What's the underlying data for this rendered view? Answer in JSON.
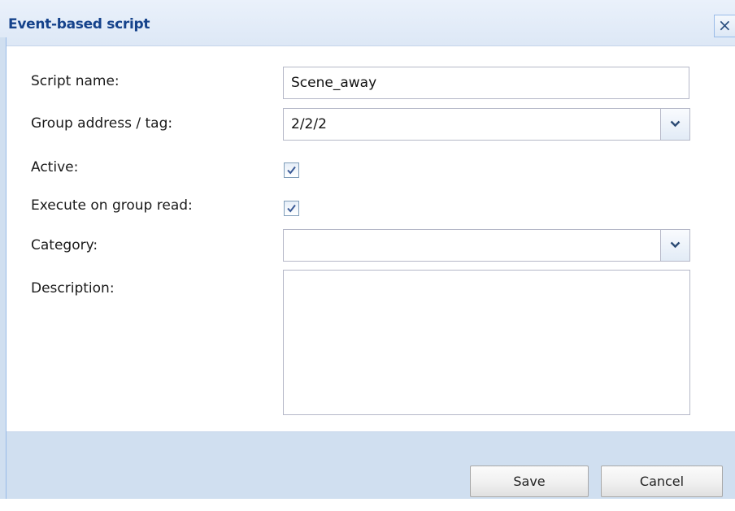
{
  "window": {
    "title": "Event-based script",
    "close_icon": "close-icon",
    "close_glyph": "✕"
  },
  "form": {
    "script_name_label": "Script name:",
    "script_name_value": "Scene_away",
    "group_address_label": "Group address / tag:",
    "group_address_value": "2/2/2",
    "active_label": "Active:",
    "active_checked": true,
    "execute_on_read_label": "Execute on group read:",
    "execute_on_read_checked": true,
    "category_label": "Category:",
    "category_value": "",
    "description_label": "Description:",
    "description_value": ""
  },
  "buttons": {
    "save_label": "Save",
    "cancel_label": "Cancel"
  },
  "colors": {
    "title_text": "#15428b",
    "footer_bg": "#d0dff0",
    "field_border": "#b5b8c8"
  }
}
